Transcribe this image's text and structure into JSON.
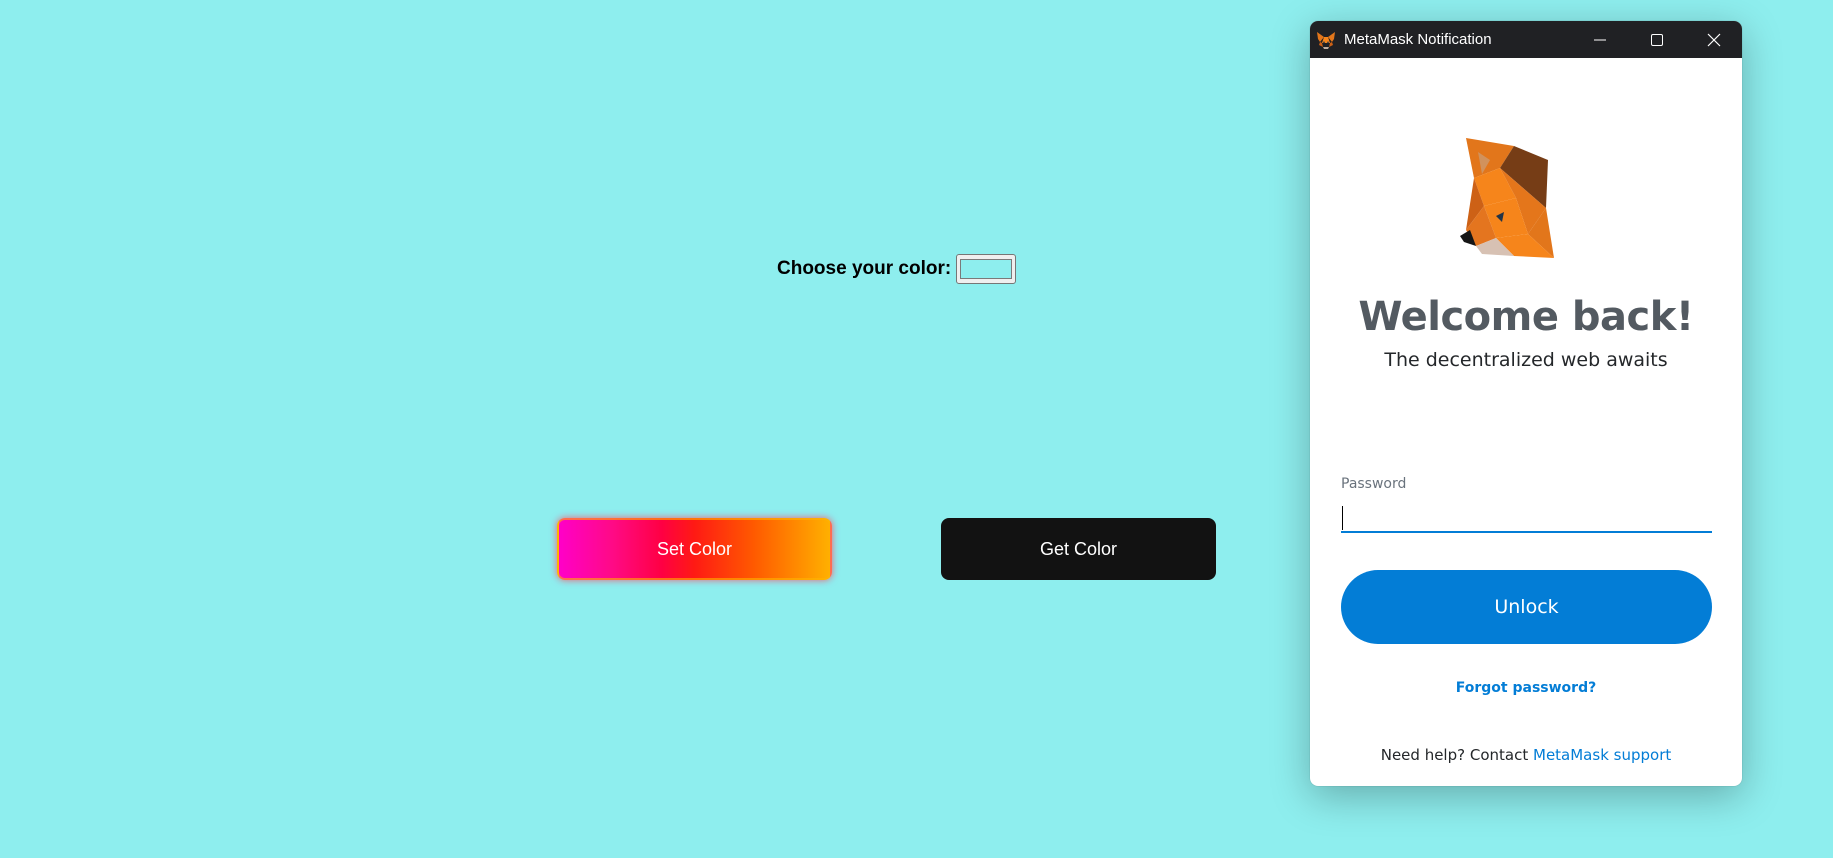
{
  "page": {
    "background_color": "#8eeeee",
    "color_picker": {
      "label": "Choose your color:",
      "selected_color": "#8eeeee"
    },
    "buttons": {
      "set_color": "Set Color",
      "get_color": "Get Color"
    }
  },
  "metamask_window": {
    "title": "MetaMask Notification",
    "controls": [
      "minimize-icon",
      "maximize-icon",
      "close-icon"
    ],
    "welcome_title": "Welcome back!",
    "tagline": "The decentralized web awaits",
    "password_label": "Password",
    "password_value": "",
    "unlock_label": "Unlock",
    "forgot_password": "Forgot password?",
    "help_prefix": "Need help? Contact",
    "help_link": "MetaMask support",
    "accent_color": "#037dd6",
    "titlebar_color": "#202124"
  }
}
